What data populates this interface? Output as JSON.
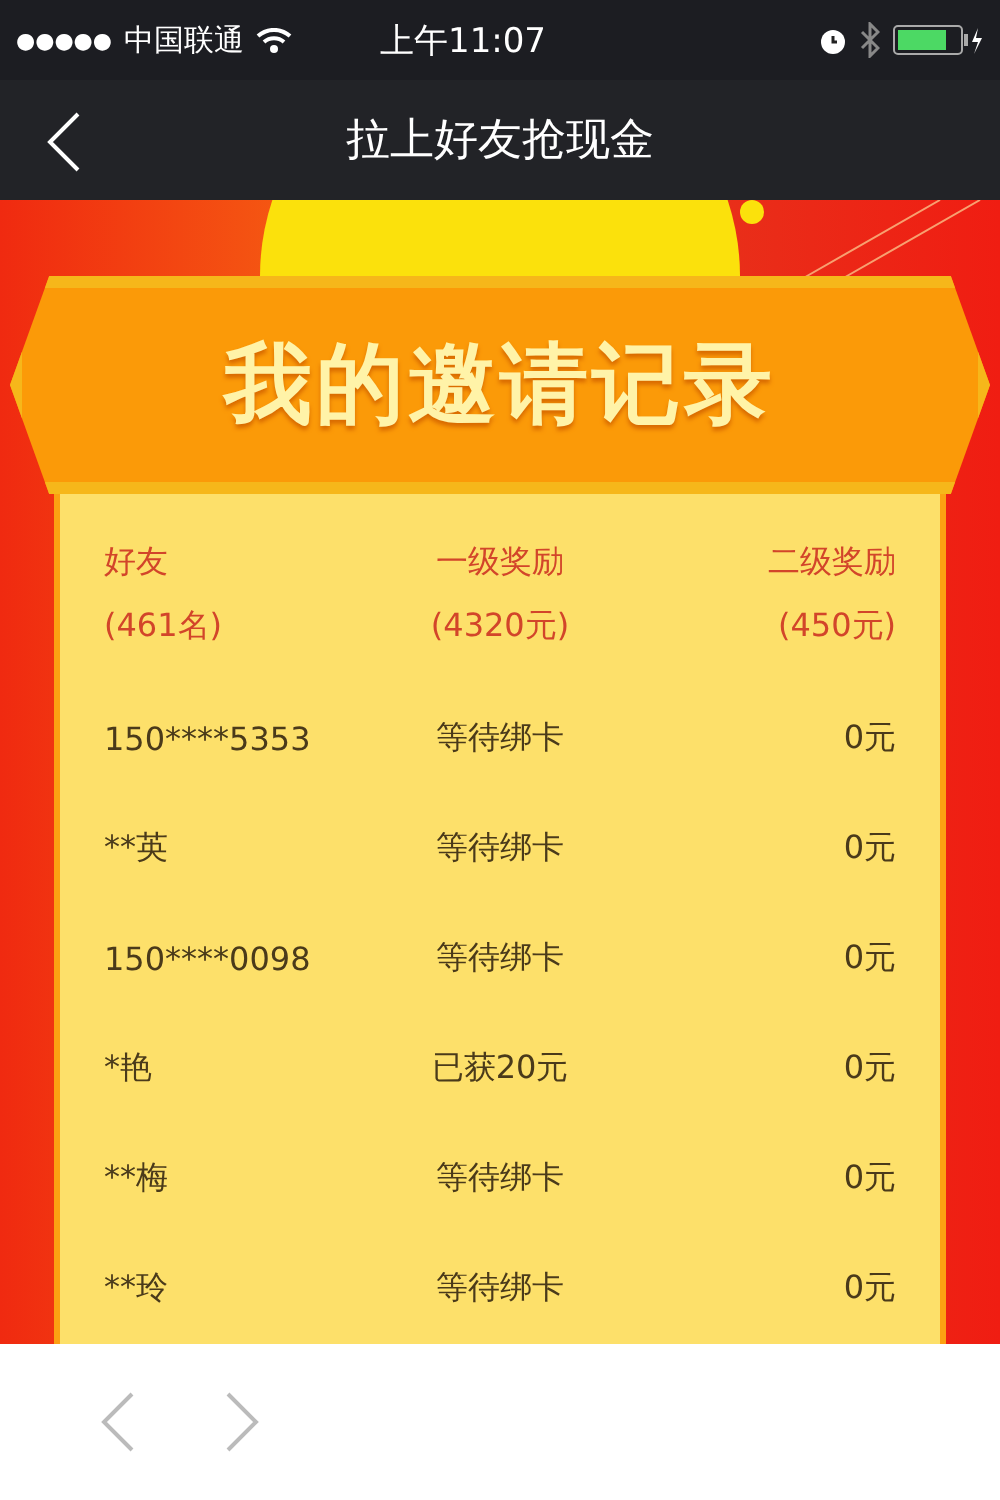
{
  "status_bar": {
    "signal_dots": "●●●●●",
    "carrier": "中国联通",
    "time": "上午11:07"
  },
  "nav_bar": {
    "title": "拉上好友抢现金"
  },
  "banner": {
    "title": "我的邀请记录"
  },
  "table": {
    "columns": [
      {
        "label": "好友",
        "total": "(461名)"
      },
      {
        "label": "一级奖励",
        "total": "(4320元)"
      },
      {
        "label": "二级奖励",
        "total": "(450元)"
      }
    ],
    "rows": [
      {
        "friend": "150****5353",
        "level1": "等待绑卡",
        "level2": "0元"
      },
      {
        "friend": "**英",
        "level1": "等待绑卡",
        "level2": "0元"
      },
      {
        "friend": "150****0098",
        "level1": "等待绑卡",
        "level2": "0元"
      },
      {
        "friend": "*艳",
        "level1": "已获20元",
        "level2": "0元"
      },
      {
        "friend": "**梅",
        "level1": "等待绑卡",
        "level2": "0元"
      },
      {
        "friend": "**玲",
        "level1": "等待绑卡",
        "level2": "0元"
      }
    ]
  }
}
